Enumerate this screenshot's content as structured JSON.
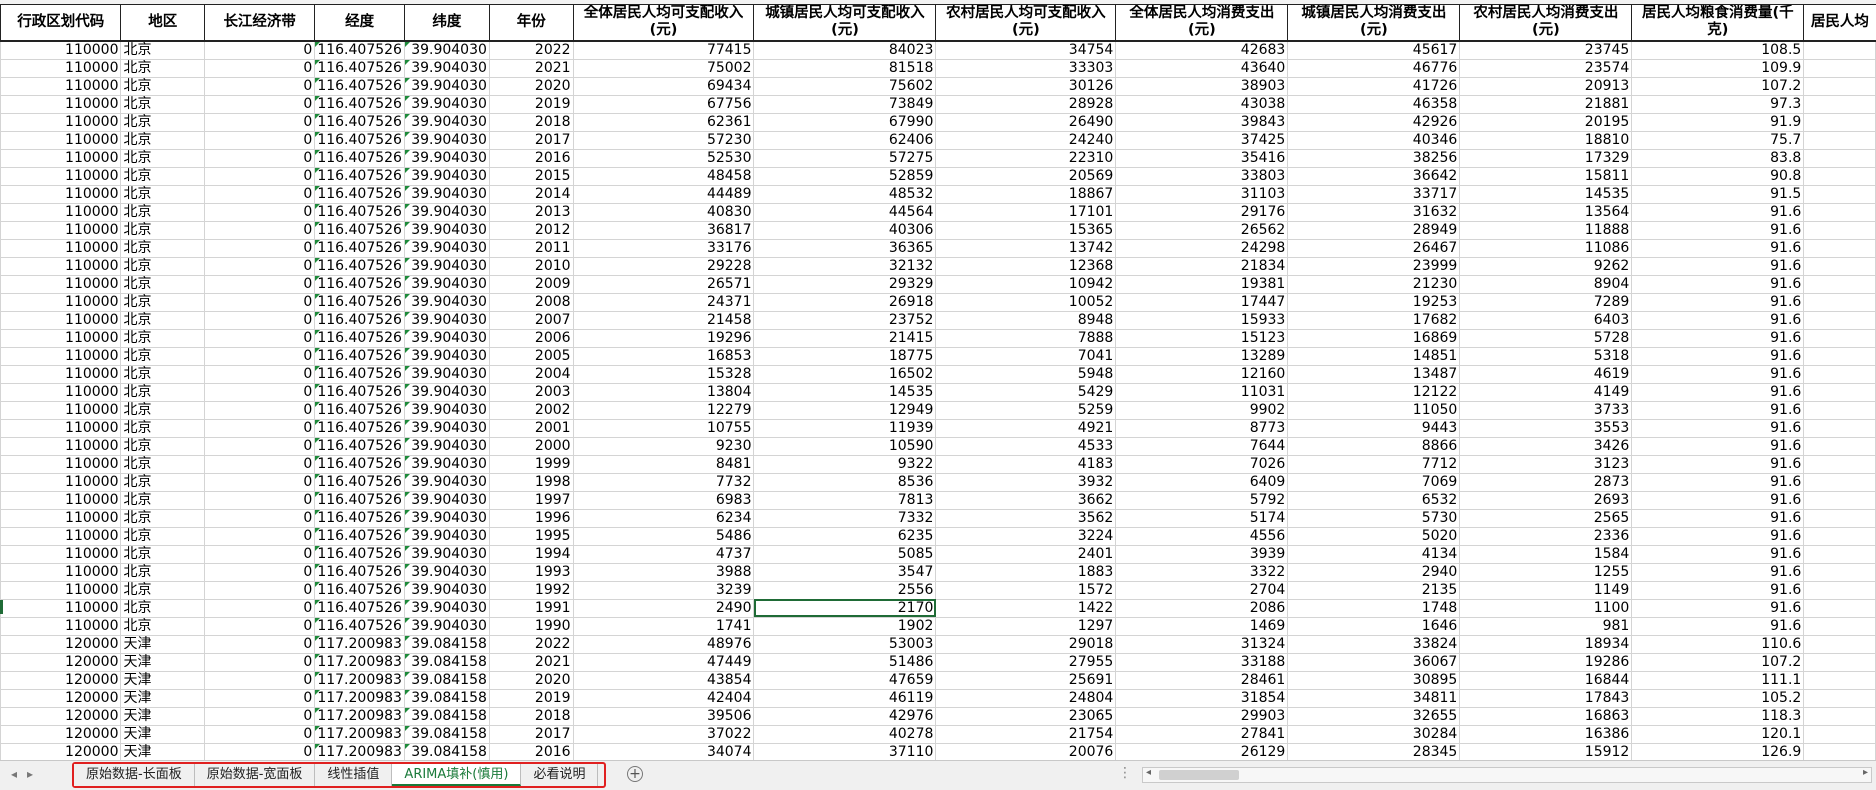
{
  "columns": [
    "行政区划代码",
    "地区",
    "长江经济带",
    "经度",
    "纬度",
    "年份",
    "全体居民人均可支配收入(元)",
    "城镇居民人均可支配收入(元)",
    "农村居民人均可支配收入(元)",
    "全体居民人均消费支出(元)",
    "城镇居民人均消费支出(元)",
    "农村居民人均消费支出(元)",
    "居民人均粮食消费量(千克)",
    "居民人均"
  ],
  "rows": [
    [
      "110000",
      "北京",
      "0",
      "116.407526",
      "39.904030",
      "2022",
      "77415",
      "84023",
      "34754",
      "42683",
      "45617",
      "23745",
      "108.5"
    ],
    [
      "110000",
      "北京",
      "0",
      "116.407526",
      "39.904030",
      "2021",
      "75002",
      "81518",
      "33303",
      "43640",
      "46776",
      "23574",
      "109.9"
    ],
    [
      "110000",
      "北京",
      "0",
      "116.407526",
      "39.904030",
      "2020",
      "69434",
      "75602",
      "30126",
      "38903",
      "41726",
      "20913",
      "107.2"
    ],
    [
      "110000",
      "北京",
      "0",
      "116.407526",
      "39.904030",
      "2019",
      "67756",
      "73849",
      "28928",
      "43038",
      "46358",
      "21881",
      "97.3"
    ],
    [
      "110000",
      "北京",
      "0",
      "116.407526",
      "39.904030",
      "2018",
      "62361",
      "67990",
      "26490",
      "39843",
      "42926",
      "20195",
      "91.9"
    ],
    [
      "110000",
      "北京",
      "0",
      "116.407526",
      "39.904030",
      "2017",
      "57230",
      "62406",
      "24240",
      "37425",
      "40346",
      "18810",
      "75.7"
    ],
    [
      "110000",
      "北京",
      "0",
      "116.407526",
      "39.904030",
      "2016",
      "52530",
      "57275",
      "22310",
      "35416",
      "38256",
      "17329",
      "83.8"
    ],
    [
      "110000",
      "北京",
      "0",
      "116.407526",
      "39.904030",
      "2015",
      "48458",
      "52859",
      "20569",
      "33803",
      "36642",
      "15811",
      "90.8"
    ],
    [
      "110000",
      "北京",
      "0",
      "116.407526",
      "39.904030",
      "2014",
      "44489",
      "48532",
      "18867",
      "31103",
      "33717",
      "14535",
      "91.5"
    ],
    [
      "110000",
      "北京",
      "0",
      "116.407526",
      "39.904030",
      "2013",
      "40830",
      "44564",
      "17101",
      "29176",
      "31632",
      "13564",
      "91.6"
    ],
    [
      "110000",
      "北京",
      "0",
      "116.407526",
      "39.904030",
      "2012",
      "36817",
      "40306",
      "15365",
      "26562",
      "28949",
      "11888",
      "91.6"
    ],
    [
      "110000",
      "北京",
      "0",
      "116.407526",
      "39.904030",
      "2011",
      "33176",
      "36365",
      "13742",
      "24298",
      "26467",
      "11086",
      "91.6"
    ],
    [
      "110000",
      "北京",
      "0",
      "116.407526",
      "39.904030",
      "2010",
      "29228",
      "32132",
      "12368",
      "21834",
      "23999",
      "9262",
      "91.6"
    ],
    [
      "110000",
      "北京",
      "0",
      "116.407526",
      "39.904030",
      "2009",
      "26571",
      "29329",
      "10942",
      "19381",
      "21230",
      "8904",
      "91.6"
    ],
    [
      "110000",
      "北京",
      "0",
      "116.407526",
      "39.904030",
      "2008",
      "24371",
      "26918",
      "10052",
      "17447",
      "19253",
      "7289",
      "91.6"
    ],
    [
      "110000",
      "北京",
      "0",
      "116.407526",
      "39.904030",
      "2007",
      "21458",
      "23752",
      "8948",
      "15933",
      "17682",
      "6403",
      "91.6"
    ],
    [
      "110000",
      "北京",
      "0",
      "116.407526",
      "39.904030",
      "2006",
      "19296",
      "21415",
      "7888",
      "15123",
      "16869",
      "5728",
      "91.6"
    ],
    [
      "110000",
      "北京",
      "0",
      "116.407526",
      "39.904030",
      "2005",
      "16853",
      "18775",
      "7041",
      "13289",
      "14851",
      "5318",
      "91.6"
    ],
    [
      "110000",
      "北京",
      "0",
      "116.407526",
      "39.904030",
      "2004",
      "15328",
      "16502",
      "5948",
      "12160",
      "13487",
      "4619",
      "91.6"
    ],
    [
      "110000",
      "北京",
      "0",
      "116.407526",
      "39.904030",
      "2003",
      "13804",
      "14535",
      "5429",
      "11031",
      "12122",
      "4149",
      "91.6"
    ],
    [
      "110000",
      "北京",
      "0",
      "116.407526",
      "39.904030",
      "2002",
      "12279",
      "12949",
      "5259",
      "9902",
      "11050",
      "3733",
      "91.6"
    ],
    [
      "110000",
      "北京",
      "0",
      "116.407526",
      "39.904030",
      "2001",
      "10755",
      "11939",
      "4921",
      "8773",
      "9443",
      "3553",
      "91.6"
    ],
    [
      "110000",
      "北京",
      "0",
      "116.407526",
      "39.904030",
      "2000",
      "9230",
      "10590",
      "4533",
      "7644",
      "8866",
      "3426",
      "91.6"
    ],
    [
      "110000",
      "北京",
      "0",
      "116.407526",
      "39.904030",
      "1999",
      "8481",
      "9322",
      "4183",
      "7026",
      "7712",
      "3123",
      "91.6"
    ],
    [
      "110000",
      "北京",
      "0",
      "116.407526",
      "39.904030",
      "1998",
      "7732",
      "8536",
      "3932",
      "6409",
      "7069",
      "2873",
      "91.6"
    ],
    [
      "110000",
      "北京",
      "0",
      "116.407526",
      "39.904030",
      "1997",
      "6983",
      "7813",
      "3662",
      "5792",
      "6532",
      "2693",
      "91.6"
    ],
    [
      "110000",
      "北京",
      "0",
      "116.407526",
      "39.904030",
      "1996",
      "6234",
      "7332",
      "3562",
      "5174",
      "5730",
      "2565",
      "91.6"
    ],
    [
      "110000",
      "北京",
      "0",
      "116.407526",
      "39.904030",
      "1995",
      "5486",
      "6235",
      "3224",
      "4556",
      "5020",
      "2336",
      "91.6"
    ],
    [
      "110000",
      "北京",
      "0",
      "116.407526",
      "39.904030",
      "1994",
      "4737",
      "5085",
      "2401",
      "3939",
      "4134",
      "1584",
      "91.6"
    ],
    [
      "110000",
      "北京",
      "0",
      "116.407526",
      "39.904030",
      "1993",
      "3988",
      "3547",
      "1883",
      "3322",
      "2940",
      "1255",
      "91.6"
    ],
    [
      "110000",
      "北京",
      "0",
      "116.407526",
      "39.904030",
      "1992",
      "3239",
      "2556",
      "1572",
      "2704",
      "2135",
      "1149",
      "91.6"
    ],
    [
      "110000",
      "北京",
      "0",
      "116.407526",
      "39.904030",
      "1991",
      "2490",
      "2170",
      "1422",
      "2086",
      "1748",
      "1100",
      "91.6"
    ],
    [
      "110000",
      "北京",
      "0",
      "116.407526",
      "39.904030",
      "1990",
      "1741",
      "1902",
      "1297",
      "1469",
      "1646",
      "981",
      "91.6"
    ],
    [
      "120000",
      "天津",
      "0",
      "117.200983",
      "39.084158",
      "2022",
      "48976",
      "53003",
      "29018",
      "31324",
      "33824",
      "18934",
      "110.6"
    ],
    [
      "120000",
      "天津",
      "0",
      "117.200983",
      "39.084158",
      "2021",
      "47449",
      "51486",
      "27955",
      "33188",
      "36067",
      "19286",
      "107.2"
    ],
    [
      "120000",
      "天津",
      "0",
      "117.200983",
      "39.084158",
      "2020",
      "43854",
      "47659",
      "25691",
      "28461",
      "30895",
      "16844",
      "111.1"
    ],
    [
      "120000",
      "天津",
      "0",
      "117.200983",
      "39.084158",
      "2019",
      "42404",
      "46119",
      "24804",
      "31854",
      "34811",
      "17843",
      "105.2"
    ],
    [
      "120000",
      "天津",
      "0",
      "117.200983",
      "39.084158",
      "2018",
      "39506",
      "42976",
      "23065",
      "29903",
      "32655",
      "16863",
      "118.3"
    ],
    [
      "120000",
      "天津",
      "0",
      "117.200983",
      "39.084158",
      "2017",
      "37022",
      "40278",
      "21754",
      "27841",
      "30284",
      "16386",
      "120.1"
    ],
    [
      "120000",
      "天津",
      "0",
      "117.200983",
      "39.084158",
      "2016",
      "34074",
      "37110",
      "20076",
      "26129",
      "28345",
      "15912",
      "126.9"
    ]
  ],
  "active_cell": {
    "row": 31,
    "col": 7
  },
  "sheet_tabs": [
    "原始数据-长面板",
    "原始数据-宽面板",
    "线性插值",
    "ARIMA填补(慎用)",
    "必看说明"
  ],
  "active_tab": 3,
  "tab_nav": {
    "prev": "◂",
    "next": "▸"
  },
  "add_sheet_label": "+",
  "more_label": "⋮",
  "scroll_arrows": {
    "left": "◂",
    "right": "▸"
  },
  "colors": {
    "accent": "#1a7a3a",
    "highlight_box": "#e02020"
  }
}
